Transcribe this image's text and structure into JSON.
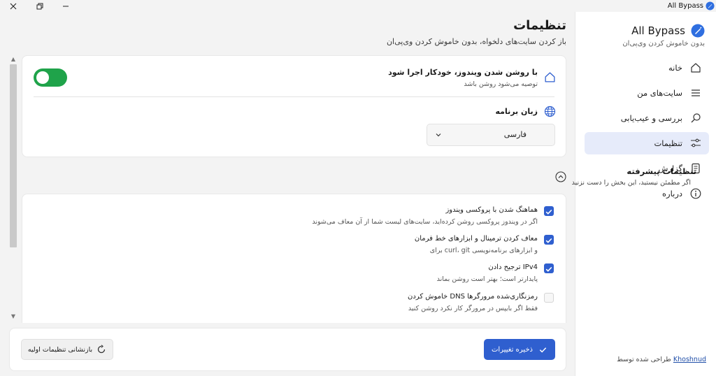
{
  "window": {
    "title": "All Bypass"
  },
  "sidebar": {
    "brand": "All Bypass",
    "tagline": "بدون خاموش کردن وی‌پی‌ان",
    "items": [
      {
        "label": "خانه",
        "icon": "home-icon"
      },
      {
        "label": "سایت‌های من",
        "icon": "list-icon"
      },
      {
        "label": "بررسی و عیب‌یابی",
        "icon": "search-icon"
      },
      {
        "label": "تنظیمات",
        "icon": "sliders-icon",
        "active": true
      },
      {
        "label": "گزارش",
        "icon": "document-icon"
      },
      {
        "label": "درباره",
        "icon": "info-icon"
      }
    ],
    "credit_prefix": "طراحی شده توسط",
    "credit_link": "Khoshnud"
  },
  "header": {
    "title": "تنظیمات",
    "subtitle": "باز کردن سایت‌های دلخواه، بدون خاموش کردن وی‌پی‌ان"
  },
  "general": {
    "autostart_title": "با روشن شدن ویندوز، خودکار اجرا شود",
    "autostart_desc": "توصیه می‌شود روشن باشد",
    "autostart_on": true,
    "language_title": "زبان برنامه",
    "language_value": "فارسی"
  },
  "advanced": {
    "title": "تنظیمات پیشرفته",
    "subtitle": "اگر مطمئن نیستید، این بخش را دست نزنید",
    "options": [
      {
        "title": "هماهنگ شدن با پروکسی ویندوز",
        "desc": "اگر در ویندوز پروکسی روشن کرده‌اید، سایت‌های لیست شما از آن معاف می‌شوند",
        "checked": true
      },
      {
        "title": "معاف کردن ترمینال و ابزارهای خط فرمان",
        "desc": "برای curl، git و ابزارهای برنامه‌نویسی",
        "checked": true
      },
      {
        "title": "ترجیح دادن IPv4",
        "desc": "پایدارتر است؛ بهتر است روشن بماند",
        "checked": true
      },
      {
        "title": "خاموش کردن DNS رمزنگاری‌شده مرورگرها",
        "desc": "فقط اگر بایپس در مرورگر کار نکرد روشن کنید",
        "checked": false
      }
    ]
  },
  "footer": {
    "save_label": "ذخیره تغییرات",
    "reset_label": "بازنشانی تنظیمات اولیه"
  },
  "colors": {
    "accent": "#2f5fcf",
    "toggle_on": "#1fa34a",
    "nav_active_bg": "#e6ebfa"
  }
}
